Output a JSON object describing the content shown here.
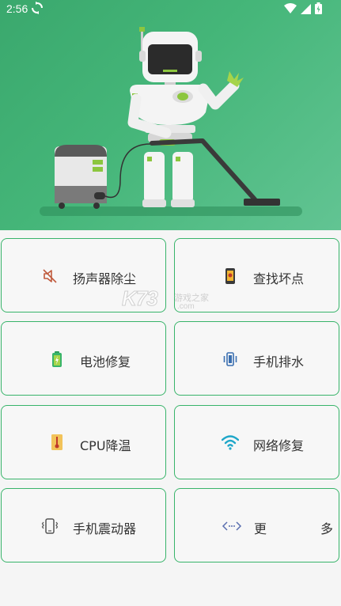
{
  "status_bar": {
    "time": "2:56"
  },
  "watermark": {
    "brand": "K73",
    "tagline": "游戏之家",
    "domain": ".com"
  },
  "tools": [
    {
      "label": "扬声器除尘",
      "icon": "speaker-muted-icon"
    },
    {
      "label": "查找坏点",
      "icon": "phone-screen-icon"
    },
    {
      "label": "电池修复",
      "icon": "battery-icon"
    },
    {
      "label": "手机排水",
      "icon": "vibrate-icon"
    },
    {
      "label": "CPU降温",
      "icon": "thermometer-icon"
    },
    {
      "label": "网络修复",
      "icon": "wifi-icon"
    },
    {
      "label": "手机震动器",
      "icon": "phone-vibrate-icon"
    },
    {
      "label": "更　　多",
      "icon": "more-arrows-icon"
    }
  ],
  "colors": {
    "accent": "#38b46a",
    "hero_green": "#45b679"
  }
}
